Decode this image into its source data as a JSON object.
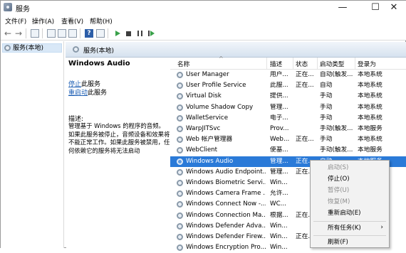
{
  "window": {
    "title": "服务",
    "minimize": "—",
    "maximize": "☐",
    "close": "✕"
  },
  "menu": [
    "文件(F)",
    "操作(A)",
    "查看(V)",
    "帮助(H)"
  ],
  "toolbar": {
    "help": "?",
    "back": "←",
    "forward": "→"
  },
  "tree": {
    "item": "服务(本地)"
  },
  "header": {
    "title": "服务(本地)"
  },
  "details": {
    "service_name": "Windows Audio",
    "stop_link": "停止",
    "stop_suffix": "此服务",
    "restart_link": "重启动",
    "restart_suffix": "此服务",
    "desc_label": "描述:",
    "desc_text": "管理基于 Windows 的程序的音频。如果此服务被停止，音频设备和效果将不能正常工作。如果此服务被禁用，任何依赖它的服务将无法启动"
  },
  "columns": {
    "name": "名称",
    "desc": "描述",
    "status": "状态",
    "startup": "启动类型",
    "logon": "登录为",
    "sort_arrow": "^"
  },
  "rows": [
    {
      "name": "User Manager",
      "desc": "用户...",
      "status": "正在...",
      "startup": "自动(触发...",
      "logon": "本地系统"
    },
    {
      "name": "User Profile Service",
      "desc": "此服...",
      "status": "正在...",
      "startup": "自动",
      "logon": "本地系统"
    },
    {
      "name": "Virtual Disk",
      "desc": "提供...",
      "status": "",
      "startup": "手动",
      "logon": "本地系统"
    },
    {
      "name": "Volume Shadow Copy",
      "desc": "管理...",
      "status": "",
      "startup": "手动",
      "logon": "本地系统"
    },
    {
      "name": "WalletService",
      "desc": "电子...",
      "status": "",
      "startup": "手动",
      "logon": "本地系统"
    },
    {
      "name": "WarpJITSvc",
      "desc": "Prov...",
      "status": "",
      "startup": "手动(触发...",
      "logon": "本地服务"
    },
    {
      "name": "Web 帐户管理器",
      "desc": "Web...",
      "status": "正在...",
      "startup": "手动",
      "logon": "本地系统"
    },
    {
      "name": "WebClient",
      "desc": "使基...",
      "status": "",
      "startup": "手动(触发...",
      "logon": "本地服务"
    },
    {
      "name": "Windows Audio",
      "desc": "管理...",
      "status": "正在...",
      "startup": "自动",
      "logon": "本地服务"
    },
    {
      "name": "Windows Audio Endpoint...",
      "desc": "管理...",
      "status": "正在...",
      "startup": "",
      "logon": ""
    },
    {
      "name": "Windows Biometric Servi...",
      "desc": "Win...",
      "status": "",
      "startup": "",
      "logon": ""
    },
    {
      "name": "Windows Camera Frame ...",
      "desc": "允许...",
      "status": "",
      "startup": "",
      "logon": ""
    },
    {
      "name": "Windows Connect Now -...",
      "desc": "WC...",
      "status": "",
      "startup": "",
      "logon": ""
    },
    {
      "name": "Windows Connection Ma...",
      "desc": "根据...",
      "status": "正在...",
      "startup": "",
      "logon": ""
    },
    {
      "name": "Windows Defender Adva...",
      "desc": "Win...",
      "status": "",
      "startup": "",
      "logon": ""
    },
    {
      "name": "Windows Defender Firew...",
      "desc": "Win...",
      "status": "正在...",
      "startup": "",
      "logon": ""
    },
    {
      "name": "Windows Encryption Pro...",
      "desc": "Win...",
      "status": "",
      "startup": "",
      "logon": ""
    }
  ],
  "context_menu": {
    "start": "启动(S)",
    "stop": "停止(O)",
    "pause": "暂停(U)",
    "resume": "恢复(M)",
    "restart": "重新启动(E)",
    "all_tasks": "所有任务(K)",
    "refresh": "刷新(F)",
    "submenu_arrow": "›"
  }
}
